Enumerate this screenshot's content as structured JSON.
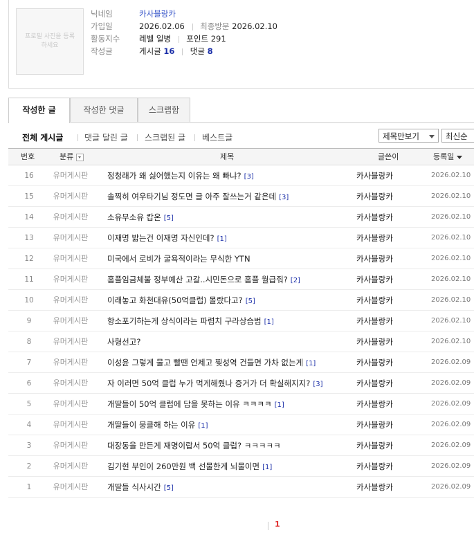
{
  "profile": {
    "photo_text": "프로필 사진을 등록하세요",
    "nickname_label": "닉네임",
    "nickname": "카사블랑카",
    "join_label": "가입일",
    "join_date": "2026.02.06",
    "last_visit_label": "최종방문",
    "last_visit": "2026.02.10",
    "activity_label": "활동지수",
    "level": "레벨 일병",
    "points": "포인트 291",
    "written_label": "작성글",
    "posts_label": "게시글",
    "posts_count": "16",
    "comments_label": "댓글",
    "comments_count": "8"
  },
  "tabs": [
    "작성한 글",
    "작성한 댓글",
    "스크랩함"
  ],
  "filters": [
    "전체 게시글",
    "댓글 달린 글",
    "스크랩된 글",
    "베스트글"
  ],
  "controls": {
    "view_select": "제목만보기",
    "sort_select": "최신순"
  },
  "columns": {
    "no": "번호",
    "category": "분류",
    "title": "제목",
    "author": "글쓴이",
    "date": "등록일"
  },
  "rows": [
    {
      "no": "16",
      "cat": "유머게시판",
      "title": "정청래가 왜 싫어했는지 이유는 왜 빠냐?",
      "cmt": "[3]",
      "author": "카사블랑카",
      "date": "2026.02.10"
    },
    {
      "no": "15",
      "cat": "유머게시판",
      "title": "솔찍히 여우타기님 정도면 글 아주 잘쓰는거 같은데",
      "cmt": "[3]",
      "author": "카사블랑카",
      "date": "2026.02.10"
    },
    {
      "no": "14",
      "cat": "유머게시판",
      "title": "소유무소유 캅온",
      "cmt": "[5]",
      "author": "카사블랑카",
      "date": "2026.02.10"
    },
    {
      "no": "13",
      "cat": "유머게시판",
      "title": "이재명 밟는건 이재명 자신인데?",
      "cmt": "[1]",
      "author": "카사블랑카",
      "date": "2026.02.10"
    },
    {
      "no": "12",
      "cat": "유머게시판",
      "title": "미국에서 로비가 굴욕적이라는 무식한 YTN",
      "cmt": "",
      "author": "카사블랑카",
      "date": "2026.02.10"
    },
    {
      "no": "11",
      "cat": "유머게시판",
      "title": "홈플임금체불 정부예산 고갈..시민돈으로 홈플 월급줘?",
      "cmt": "[2]",
      "author": "카사블랑카",
      "date": "2026.02.10"
    },
    {
      "no": "10",
      "cat": "유머게시판",
      "title": "이래놓고 화천대유(50억클럽) 몰랐다고?",
      "cmt": "[5]",
      "author": "카사블랑카",
      "date": "2026.02.10"
    },
    {
      "no": "9",
      "cat": "유머게시판",
      "title": "항소포기하는게 상식이라는 파렴치 구라상습범",
      "cmt": "[1]",
      "author": "카사블랑카",
      "date": "2026.02.10"
    },
    {
      "no": "8",
      "cat": "유머게시판",
      "title": "사형선고?",
      "cmt": "",
      "author": "카사블랑카",
      "date": "2026.02.10"
    },
    {
      "no": "7",
      "cat": "유머게시판",
      "title": "이성윤 그렇게 물고 빨땐 언제고 찢성역 건들면 가차 없는게",
      "cmt": "[1]",
      "author": "카사블랑카",
      "date": "2026.02.09"
    },
    {
      "no": "6",
      "cat": "유머게시판",
      "title": "자 이러면 50억 클럽 누가 먹게해줬나 증거가 더 확실해지지?",
      "cmt": "[3]",
      "author": "카사블랑카",
      "date": "2026.02.09"
    },
    {
      "no": "5",
      "cat": "유머게시판",
      "title": "개딸들이 50억 클럽에 답을 못하는 이유 ㅋㅋㅋㅋ",
      "cmt": "[1]",
      "author": "카사블랑카",
      "date": "2026.02.09"
    },
    {
      "no": "4",
      "cat": "유머게시판",
      "title": "개딸들이 뭉클해 하는 이유",
      "cmt": "[1]",
      "author": "카사블랑카",
      "date": "2026.02.09"
    },
    {
      "no": "3",
      "cat": "유머게시판",
      "title": "대장동을 만든게 재명이랍서 50억 클럽? ㅋㅋㅋㅋㅋ",
      "cmt": "",
      "author": "카사블랑카",
      "date": "2026.02.09"
    },
    {
      "no": "2",
      "cat": "유머게시판",
      "title": "김기현 부인이 260만원 백 선물한게 뇌물이면",
      "cmt": "[1]",
      "author": "카사블랑카",
      "date": "2026.02.09"
    },
    {
      "no": "1",
      "cat": "유머게시판",
      "title": "개딸들 식사시간",
      "cmt": "[5]",
      "author": "카사블랑카",
      "date": "2026.02.09"
    }
  ],
  "pagination": {
    "current": "1"
  },
  "colors": {
    "link_blue": "#1a2ea8",
    "nick_blue": "#3654c8",
    "page_red": "#e03030"
  }
}
